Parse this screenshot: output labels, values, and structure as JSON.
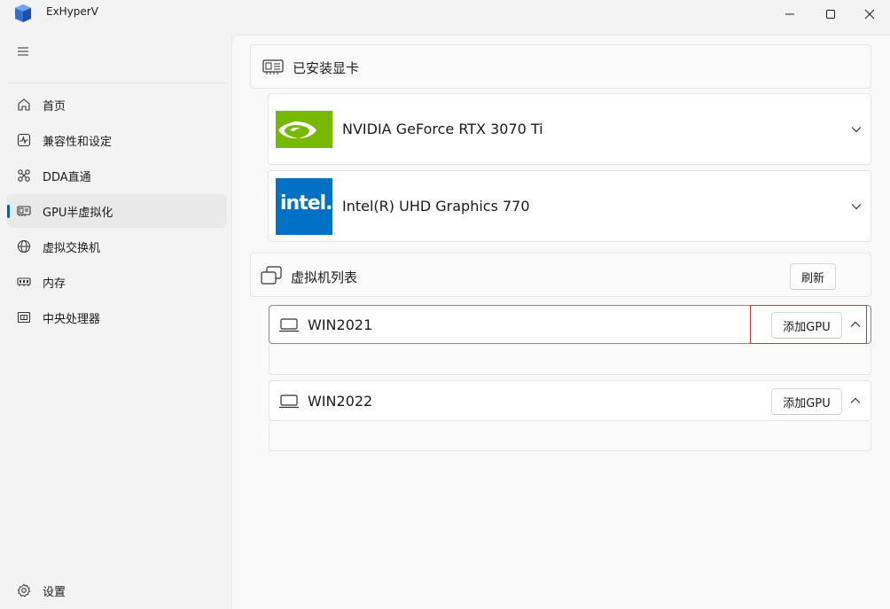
{
  "window": {
    "title": "ExHyperV"
  },
  "nav": {
    "items": [
      {
        "label": "首页",
        "icon": "home-icon"
      },
      {
        "label": "兼容性和设定",
        "icon": "activity-icon"
      },
      {
        "label": "DDA直通",
        "icon": "link-icon"
      },
      {
        "label": "GPU半虚拟化",
        "icon": "gpu-icon",
        "selected": true
      },
      {
        "label": "虚拟交换机",
        "icon": "globe-icon"
      },
      {
        "label": "内存",
        "icon": "memory-icon"
      },
      {
        "label": "中央处理器",
        "icon": "cpu-icon"
      }
    ],
    "settings_label": "设置"
  },
  "main": {
    "installed_gpus_title": "已安装显卡",
    "gpus": [
      {
        "name": "NVIDIA GeForce RTX 3070 Ti",
        "vendor_icon": "nvidia-logo"
      },
      {
        "name": "Intel(R) UHD Graphics 770",
        "vendor_icon": "intel-logo",
        "logo_text": "intel."
      }
    ],
    "vm_list_title": "虚拟机列表",
    "refresh_label": "刷新",
    "vms": [
      {
        "name": "WIN2021",
        "add_gpu_label": "添加GPU",
        "expanded": true
      },
      {
        "name": "WIN2022",
        "add_gpu_label": "添加GPU",
        "expanded": true
      }
    ]
  },
  "colors": {
    "accent": "#005fb8",
    "nvidia_green": "#76b900",
    "intel_blue": "#0071c5",
    "highlight_red": "#e03131"
  }
}
